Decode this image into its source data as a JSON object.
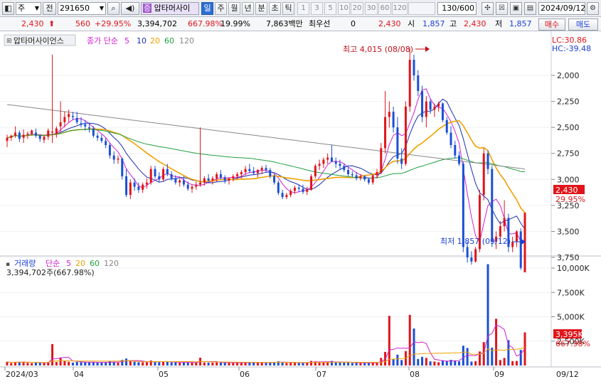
{
  "toolbar": {
    "market": "주",
    "prev_label": "전",
    "code": "291650",
    "name": "압타머사이",
    "name_icon": "증",
    "tabs": [
      "일",
      "주",
      "월",
      "년",
      "분",
      "초",
      "틱"
    ],
    "selected_tab": "일",
    "intervals": [
      "1",
      "3",
      "5",
      "10",
      "20",
      "30",
      "60",
      "120"
    ],
    "count": "130/600",
    "date": "2024/09/12"
  },
  "quote": {
    "price": "2,430",
    "change": "560",
    "change_pct": "+29.95%",
    "volume": "3,394,702",
    "volume_pct": "667.98%",
    "turnover": "19.99%",
    "amount": "7,863백만",
    "pref_label": "최우선",
    "pref_value": "0",
    "current": "2,430",
    "open_label": "시",
    "open": "1,857",
    "high_label": "고",
    "high": "2,430",
    "low_label": "저",
    "low": "1,857",
    "buy": "매수",
    "sell": "매도"
  },
  "price_panel": {
    "name": "압타머사이언스",
    "ma_label": "종가 단순",
    "ma_periods": [
      "5",
      "10",
      "20",
      "60",
      "120"
    ],
    "lc": "LC:30.86",
    "hc": "HC:-39.48",
    "y_ticks": [
      "3,750",
      "3,500",
      "3,250",
      "3,000",
      "2,750",
      "2,500",
      "2,250",
      "2,000"
    ],
    "current_tag": "2,430",
    "current_pct": "29.95%",
    "high_note": "최고 4,015 (08/08)",
    "low_note": "최저 1,857 (09/12)"
  },
  "volume_panel": {
    "name": "거래량",
    "ma_label": "단순",
    "ma_periods": [
      "5",
      "20",
      "60",
      "120"
    ],
    "value": "3,394,702주(667.98%)",
    "y_ticks": [
      "10,000K",
      "7,500K",
      "5,000K",
      "2,500K"
    ],
    "current_tag": "3,395K",
    "current_pct": "667.98%"
  },
  "x_axis": {
    "labels": [
      "2024/03",
      "04",
      "05",
      "06",
      "07",
      "08",
      "09"
    ],
    "last_label": "09/12"
  },
  "colors": {
    "up": "#e0151b",
    "down": "#1a4fd6",
    "ma5": "#d020d0",
    "ma10": "#1a2fb0",
    "ma20": "#f0a000",
    "ma60": "#20a040",
    "ma120": "#888888"
  },
  "chart_data": {
    "type": "candlestick",
    "x_labels": [
      "2024/03",
      "04",
      "05",
      "06",
      "07",
      "08",
      "09"
    ],
    "ylim": [
      1900,
      4050
    ],
    "y_ticks": [
      2000,
      2250,
      2500,
      2750,
      3000,
      3250,
      3500,
      3750
    ],
    "ohlc": [
      [
        3120,
        3180,
        3060,
        3150
      ],
      [
        3150,
        3180,
        3120,
        3170
      ],
      [
        3170,
        3260,
        3150,
        3200
      ],
      [
        3200,
        3220,
        3110,
        3140
      ],
      [
        3150,
        3230,
        3100,
        3180
      ],
      [
        3180,
        3210,
        3140,
        3190
      ],
      [
        3190,
        3230,
        3170,
        3220
      ],
      [
        3200,
        3240,
        3150,
        3170
      ],
      [
        3170,
        3180,
        3110,
        3140
      ],
      [
        3130,
        3170,
        3100,
        3160
      ],
      [
        3160,
        3240,
        3130,
        3220
      ],
      [
        3200,
        3950,
        3100,
        3210
      ],
      [
        3190,
        3260,
        3150,
        3240
      ],
      [
        3260,
        3500,
        3200,
        3300
      ],
      [
        3300,
        3400,
        3250,
        3350
      ],
      [
        3350,
        3420,
        3300,
        3380
      ],
      [
        3360,
        3400,
        3320,
        3350
      ],
      [
        3340,
        3400,
        3280,
        3300
      ],
      [
        3290,
        3350,
        3250,
        3280
      ],
      [
        3280,
        3320,
        3220,
        3260
      ],
      [
        3250,
        3290,
        3200,
        3240
      ],
      [
        3240,
        3260,
        3150,
        3170
      ],
      [
        3170,
        3200,
        3120,
        3150
      ],
      [
        3150,
        3180,
        3100,
        3120
      ],
      [
        3120,
        3150,
        3050,
        3080
      ],
      [
        3080,
        3100,
        2950,
        2980
      ],
      [
        2980,
        3020,
        2900,
        2940
      ],
      [
        2940,
        2980,
        2900,
        2950
      ],
      [
        2950,
        2960,
        2750,
        2780
      ],
      [
        2780,
        2850,
        2580,
        2600
      ],
      [
        2600,
        2750,
        2560,
        2720
      ],
      [
        2720,
        2760,
        2640,
        2680
      ],
      [
        2680,
        2720,
        2620,
        2650
      ],
      [
        2650,
        2720,
        2620,
        2700
      ],
      [
        2700,
        2760,
        2660,
        2720
      ],
      [
        2720,
        2880,
        2700,
        2850
      ],
      [
        2850,
        2880,
        2760,
        2780
      ],
      [
        2780,
        2820,
        2720,
        2750
      ],
      [
        2750,
        2870,
        2730,
        2850
      ],
      [
        2850,
        2900,
        2780,
        2800
      ],
      [
        2800,
        2830,
        2740,
        2760
      ],
      [
        2760,
        2790,
        2700,
        2720
      ],
      [
        2720,
        2760,
        2680,
        2740
      ],
      [
        2740,
        2780,
        2680,
        2700
      ],
      [
        2700,
        2730,
        2640,
        2660
      ],
      [
        2660,
        2700,
        2620,
        2680
      ],
      [
        2680,
        2730,
        2650,
        2700
      ],
      [
        2700,
        3250,
        2680,
        2720
      ],
      [
        2720,
        2780,
        2690,
        2760
      ],
      [
        2760,
        2800,
        2720,
        2740
      ],
      [
        2740,
        2780,
        2700,
        2760
      ],
      [
        2760,
        2820,
        2730,
        2800
      ],
      [
        2800,
        2840,
        2750,
        2770
      ],
      [
        2770,
        2790,
        2710,
        2740
      ],
      [
        2740,
        2770,
        2700,
        2760
      ],
      [
        2760,
        2800,
        2730,
        2780
      ],
      [
        2780,
        2820,
        2750,
        2800
      ],
      [
        2800,
        2840,
        2760,
        2820
      ],
      [
        2820,
        2880,
        2790,
        2850
      ],
      [
        2850,
        2900,
        2810,
        2830
      ],
      [
        2830,
        2870,
        2790,
        2810
      ],
      [
        2810,
        2850,
        2770,
        2840
      ],
      [
        2840,
        2880,
        2800,
        2860
      ],
      [
        2860,
        2890,
        2820,
        2840
      ],
      [
        2840,
        2860,
        2760,
        2780
      ],
      [
        2780,
        2800,
        2700,
        2720
      ],
      [
        2720,
        2740,
        2600,
        2620
      ],
      [
        2620,
        2650,
        2560,
        2580
      ],
      [
        2580,
        2620,
        2560,
        2600
      ],
      [
        2600,
        2660,
        2580,
        2640
      ],
      [
        2640,
        2690,
        2610,
        2670
      ],
      [
        2670,
        2700,
        2630,
        2660
      ],
      [
        2660,
        2700,
        2610,
        2630
      ],
      [
        2630,
        2680,
        2600,
        2650
      ],
      [
        2650,
        2800,
        2640,
        2780
      ],
      [
        2780,
        2900,
        2760,
        2880
      ],
      [
        2880,
        2940,
        2840,
        2900
      ],
      [
        2900,
        2960,
        2860,
        2940
      ],
      [
        2940,
        3000,
        2900,
        2960
      ],
      [
        2960,
        3080,
        2920,
        2920
      ],
      [
        2920,
        2960,
        2860,
        2900
      ],
      [
        2900,
        2940,
        2850,
        2880
      ],
      [
        2880,
        2900,
        2820,
        2840
      ],
      [
        2840,
        2870,
        2780,
        2800
      ],
      [
        2800,
        2830,
        2770,
        2790
      ],
      [
        2790,
        2820,
        2740,
        2760
      ],
      [
        2760,
        2800,
        2740,
        2780
      ],
      [
        2780,
        2790,
        2730,
        2750
      ],
      [
        2750,
        2770,
        2700,
        2720
      ],
      [
        2720,
        2800,
        2700,
        2790
      ],
      [
        2790,
        2850,
        2760,
        2820
      ],
      [
        2820,
        3100,
        2800,
        3050
      ],
      [
        3050,
        3600,
        3000,
        3350
      ],
      [
        3350,
        3500,
        3250,
        3400
      ],
      [
        3400,
        3450,
        3200,
        3250
      ],
      [
        3250,
        3350,
        2900,
        2950
      ],
      [
        2950,
        3050,
        2850,
        2900
      ],
      [
        2900,
        3500,
        2880,
        3450
      ],
      [
        3450,
        4015,
        3400,
        3900
      ],
      [
        3900,
        3950,
        3700,
        3750
      ],
      [
        3750,
        3800,
        3550,
        3600
      ],
      [
        3600,
        3650,
        3300,
        3350
      ],
      [
        3350,
        3550,
        3250,
        3500
      ],
      [
        3500,
        3520,
        3380,
        3420
      ],
      [
        3420,
        3480,
        3350,
        3450
      ],
      [
        3450,
        3500,
        3400,
        3480
      ],
      [
        3480,
        3490,
        3300,
        3320
      ],
      [
        3320,
        3350,
        3180,
        3200
      ],
      [
        3200,
        3260,
        3050,
        3080
      ],
      [
        3080,
        3120,
        2950,
        2980
      ],
      [
        2980,
        3020,
        2880,
        2900
      ],
      [
        2900,
        2920,
        2050,
        2100
      ],
      [
        2100,
        2150,
        1950,
        2000
      ],
      [
        2000,
        2060,
        1930,
        1960
      ],
      [
        1960,
        2100,
        1950,
        2080
      ],
      [
        2080,
        2650,
        2050,
        2600
      ],
      [
        2600,
        3050,
        2550,
        3000
      ],
      [
        3000,
        3030,
        2800,
        2850
      ],
      [
        2850,
        2880,
        2100,
        2150
      ],
      [
        2150,
        2250,
        2080,
        2200
      ],
      [
        2200,
        2350,
        2150,
        2300
      ],
      [
        2300,
        2550,
        2250,
        2380
      ],
      [
        2380,
        2420,
        2050,
        2100
      ],
      [
        2100,
        2200,
        2050,
        2150
      ],
      [
        2150,
        2260,
        2100,
        2250
      ],
      [
        2250,
        2280,
        1880,
        1900
      ],
      [
        1857,
        2430,
        1857,
        2430
      ]
    ]
  }
}
